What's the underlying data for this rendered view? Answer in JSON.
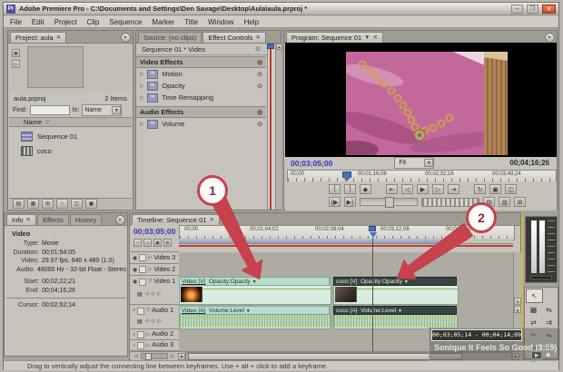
{
  "colors": {
    "accent_red": "#c7424d",
    "timecode_blue": "#3434b4",
    "clip_mint": "#cde7db"
  },
  "titlebar": {
    "title": "Adobe Premiere Pro - C:\\Documents and Settings\\Den Savage\\Desktop\\Aula\\aula.prproj *",
    "app_initials": "Pr"
  },
  "menu": {
    "items": [
      "File",
      "Edit",
      "Project",
      "Clip",
      "Sequence",
      "Marker",
      "Title",
      "Window",
      "Help"
    ]
  },
  "project": {
    "tab": "Project: aula",
    "file_name": "aula.prproj",
    "item_count": "2 Items",
    "find_label": "Find:",
    "in_label": "In:",
    "in_value": "Name",
    "name_column": "Name",
    "items": [
      {
        "name": "Sequence 01"
      },
      {
        "name": "coco"
      }
    ]
  },
  "effect_controls": {
    "source_tab": "Source: (no clips)",
    "tab": "Effect Controls",
    "clip_header": "Sequence 01 * Video",
    "video_effects_label": "Video Effects",
    "audio_effects_label": "Audio Effects",
    "fx_badge": "fx",
    "rows": {
      "motion": "Motion",
      "opacity": "Opacity",
      "time_remapping": "Time Remapping",
      "volume": "Volume"
    }
  },
  "program": {
    "tab": "Program: Sequence 01",
    "current_time": "00;03;05;00",
    "zoom_select": "Fit",
    "duration": "00;04;16;26",
    "ruler_labels": [
      "00;00",
      "00;01;16;08",
      "00;02;32;16",
      "00;03;48;24"
    ]
  },
  "info": {
    "tab": "Info",
    "effects_tab": "Effects",
    "history_tab": "History",
    "clip_name": "Video",
    "rows": [
      {
        "label": "Type:",
        "value": "Movie"
      },
      {
        "label": "Duration:",
        "value": "00;01;54;05"
      },
      {
        "label": "Video:",
        "value": "29.97 fps, 640 x 480 (1.0)"
      },
      {
        "label": "Audio:",
        "value": "48000 Hz - 32-bit Float - Stereo"
      }
    ],
    "start_label": "Start:",
    "start": "00;02;22;21",
    "end_label": "End:",
    "end": "00;04;16;26",
    "cursor_label": "Cursor:",
    "cursor": "00;02;52;14"
  },
  "timeline": {
    "tab": "Timeline: Sequence 01",
    "current_time": "00;03;05;00",
    "ruler_labels": [
      "00;00",
      "00;01;04;02",
      "00;02;08;04",
      "00;03;12;06",
      "00;04;16;08"
    ],
    "tracks": {
      "video3": "Video 3",
      "video2": "Video 2",
      "video1": "Video 1",
      "audio1": "Audio 1",
      "audio2": "Audio 2",
      "audio3": "Audio 3"
    },
    "clips": {
      "video_v": {
        "name": "Video [V]",
        "effect": "Opacity:Opacity"
      },
      "coco_v": {
        "name": "coco [V]",
        "effect": "Opacity:Opacity"
      },
      "video_a": {
        "name": "Video [A]",
        "effect": "Volume:Level"
      },
      "coco_a": {
        "name": "coco [A]",
        "effect": "Volume:Level"
      }
    }
  },
  "callouts": {
    "step1": "1",
    "step2": "2"
  },
  "player_overlay": {
    "tooltip": "00;03;05;14 - 00;04;14;09",
    "caption": "Sonique It Feels So Good (3:59)"
  },
  "statusbar": {
    "text": "Drag to vertically adjust the connecting line between keyframes. Use + alt + click to add a keyframe."
  }
}
